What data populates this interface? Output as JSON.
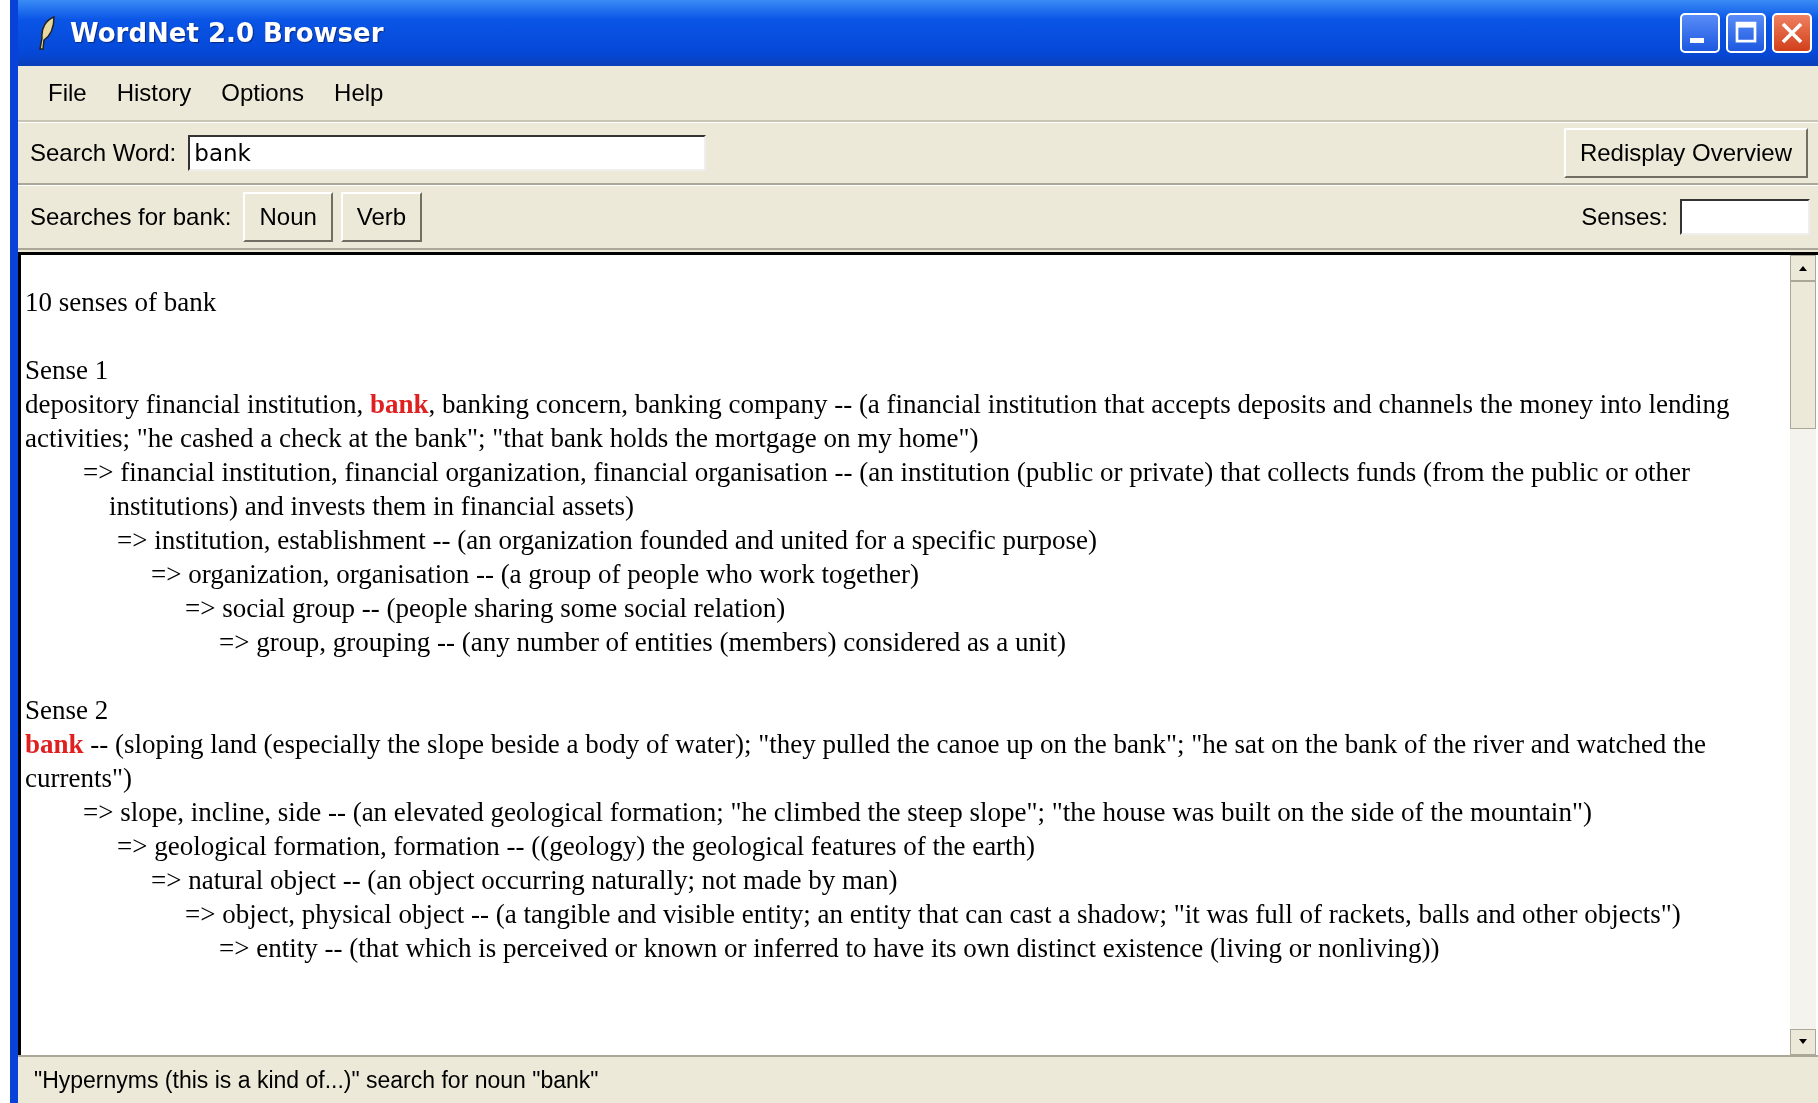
{
  "window": {
    "title": "WordNet 2.0 Browser"
  },
  "menu": [
    "File",
    "History",
    "Options",
    "Help"
  ],
  "search": {
    "label": "Search Word:",
    "value": "bank",
    "button": "Redisplay Overview"
  },
  "searches": {
    "label": "Searches for bank:",
    "buttons": [
      "Noun",
      "Verb"
    ],
    "senses_label": "Senses:"
  },
  "results": {
    "summary": "10 senses of bank",
    "senses": [
      {
        "heading": "Sense 1",
        "before": "depository financial institution, ",
        "head": "bank",
        "after": ", banking concern, banking company -- (a financial institution that accepts deposits and channels the money into lending activities; \"he cashed a check at the bank\"; \"that bank holds the mortgage on my home\")",
        "hypernyms": [
          {
            "text": "=> financial institution, financial organization, financial organisation -- (an institution (public or private) that collects funds (from the public or other institutions) and invests them in financial assets)",
            "children": [
              {
                "text": "=> institution, establishment -- (an organization founded and united for a specific purpose)",
                "children": [
                  {
                    "text": "=> organization, organisation -- (a group of people who work together)",
                    "children": [
                      {
                        "text": "=> social group -- (people sharing some social relation)",
                        "children": [
                          {
                            "text": "=> group, grouping -- (any number of entities (members) considered as a unit)"
                          }
                        ]
                      }
                    ]
                  }
                ]
              }
            ]
          }
        ]
      },
      {
        "heading": "Sense 2",
        "head": "bank",
        "after": " -- (sloping land (especially the slope beside a body of water); \"they pulled the canoe up on the bank\"; \"he sat on the bank of the river and watched the currents\")",
        "hypernyms": [
          {
            "text": "=> slope, incline, side -- (an elevated geological formation; \"he climbed the steep slope\"; \"the house was built on the side of the mountain\")",
            "children": [
              {
                "text": "=> geological formation, formation -- ((geology) the geological features of the earth)",
                "children": [
                  {
                    "text": "=> natural object -- (an object occurring naturally; not made by man)",
                    "children": [
                      {
                        "text": "=> object, physical object -- (a tangible and visible entity; an entity that can cast a shadow; \"it was full of rackets, balls and other objects\")",
                        "children": [
                          {
                            "text": "=> entity -- (that which is perceived or known or inferred to have its own distinct existence (living or nonliving))"
                          }
                        ]
                      }
                    ]
                  }
                ]
              }
            ]
          }
        ]
      }
    ]
  },
  "status_bar": "\"Hypernyms (this is a kind of...)\" search for noun \"bank\""
}
